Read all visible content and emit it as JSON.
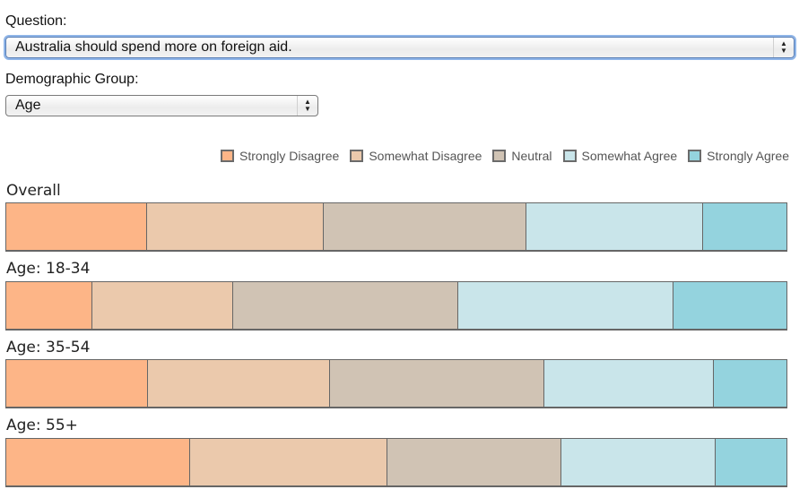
{
  "question": {
    "label": "Question:",
    "selected": "Australia should spend more on foreign aid."
  },
  "demographic": {
    "label": "Demographic Group:",
    "selected": "Age"
  },
  "select_arrows": {
    "up": "▲",
    "down": "▼"
  },
  "chart_data": {
    "type": "bar",
    "orientation": "horizontal-stacked-100",
    "title": "",
    "xlabel": "",
    "ylabel": "",
    "xlim": [
      0,
      100
    ],
    "legend_position": "top-right",
    "categories": [
      "Overall",
      "Age: 18-34",
      "Age: 35-54",
      "Age: 55+"
    ],
    "series": [
      {
        "name": "Strongly Disagree",
        "color": "#fdb587",
        "values": [
          18.0,
          11.0,
          18.2,
          23.6
        ]
      },
      {
        "name": "Somewhat Disagree",
        "color": "#ebc9ac",
        "values": [
          22.7,
          18.1,
          23.3,
          25.3
        ]
      },
      {
        "name": "Neutral",
        "color": "#d0c3b4",
        "values": [
          26.0,
          28.8,
          27.5,
          22.2
        ]
      },
      {
        "name": "Somewhat Agree",
        "color": "#c9e5ea",
        "values": [
          22.6,
          27.6,
          21.7,
          19.8
        ]
      },
      {
        "name": "Strongly Agree",
        "color": "#94d3de",
        "values": [
          10.7,
          14.5,
          9.3,
          9.1
        ]
      }
    ]
  }
}
